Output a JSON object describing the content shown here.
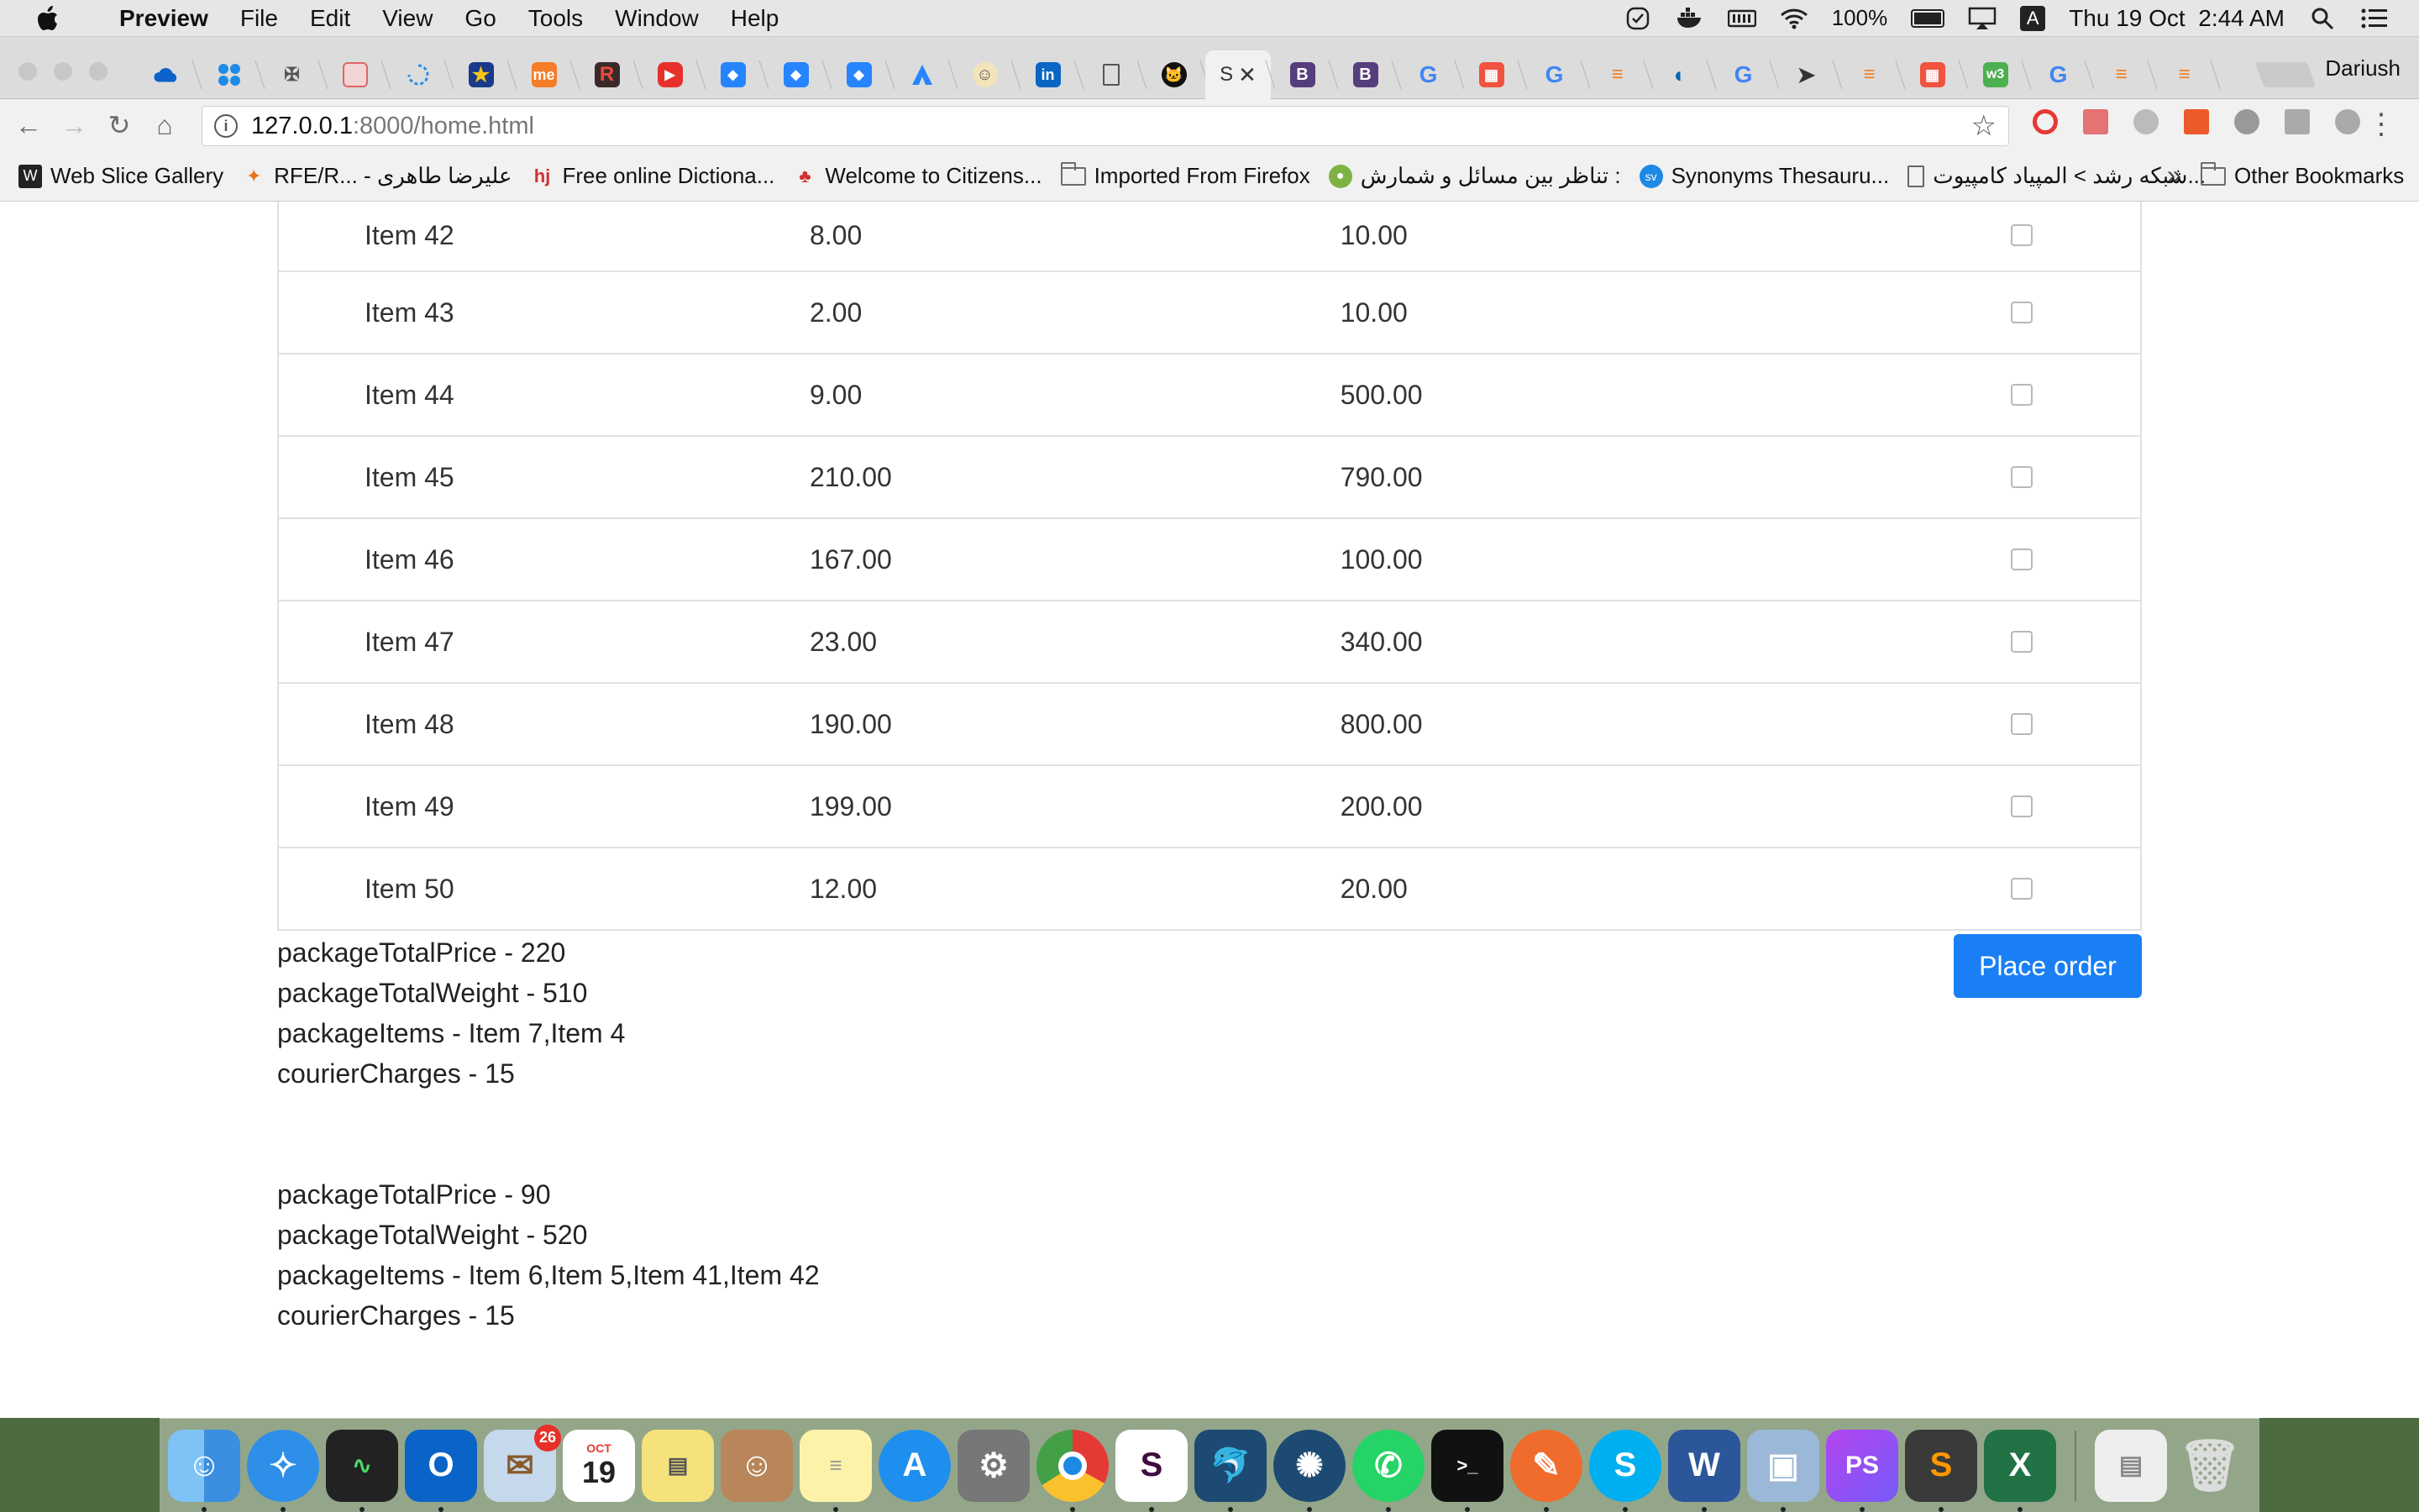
{
  "menubar": {
    "app_name": "Preview",
    "menus": [
      "File",
      "Edit",
      "View",
      "Go",
      "Tools",
      "Window",
      "Help"
    ],
    "battery_percent": "100%",
    "input_source": "A",
    "clock": "Thu 19 Oct  2:44 AM"
  },
  "browser": {
    "profile_name": "Dariush",
    "active_tab_title": "S",
    "url_host": "127.0.0.1",
    "url_path": ":8000/home.html",
    "bookmarks": [
      {
        "label": "Web Slice Gallery",
        "icon": "web-slice-icon"
      },
      {
        "label": "RFE/R... - علیرضا طاهری",
        "icon": "rfe-icon"
      },
      {
        "label": "Free online Dictiona...",
        "icon": "hj-icon"
      },
      {
        "label": "Welcome to Citizens...",
        "icon": "maple-leaf-icon"
      },
      {
        "label": "Imported From Firefox",
        "icon": "folder-icon"
      },
      {
        "label": "تناظر بین مسائل و شمارش :",
        "icon": "green-leaf-icon"
      },
      {
        "label": "Synonyms Thesauru...",
        "icon": "sv-icon"
      },
      {
        "label": "شبکه رشد > المپیاد کامپیوت...",
        "icon": "document-icon"
      }
    ],
    "other_bookmarks": "Other Bookmarks",
    "overflow": "»"
  },
  "table": {
    "rows": [
      {
        "name": "Item 42",
        "price": "8.00",
        "weight": "10.00"
      },
      {
        "name": "Item 43",
        "price": "2.00",
        "weight": "10.00"
      },
      {
        "name": "Item 44",
        "price": "9.00",
        "weight": "500.00"
      },
      {
        "name": "Item 45",
        "price": "210.00",
        "weight": "790.00"
      },
      {
        "name": "Item 46",
        "price": "167.00",
        "weight": "100.00"
      },
      {
        "name": "Item 47",
        "price": "23.00",
        "weight": "340.00"
      },
      {
        "name": "Item 48",
        "price": "190.00",
        "weight": "800.00"
      },
      {
        "name": "Item 49",
        "price": "199.00",
        "weight": "200.00"
      },
      {
        "name": "Item 50",
        "price": "12.00",
        "weight": "20.00"
      }
    ]
  },
  "place_order_label": "Place order",
  "packages": [
    {
      "total_price": "packageTotalPrice - 220",
      "total_weight": "packageTotalWeight - 510",
      "items": "packageItems - Item 7,Item 4",
      "courier": "courierCharges - 15"
    },
    {
      "total_price": "packageTotalPrice - 90",
      "total_weight": "packageTotalWeight - 520",
      "items": "packageItems - Item 6,Item 5,Item 41,Item 42",
      "courier": "courierCharges - 15"
    }
  ],
  "dock": {
    "calendar_month": "OCT",
    "calendar_day": "19",
    "mail_badge": "26"
  },
  "colors": {
    "accent": "#1a7ff4",
    "table_border": "#dee2e6"
  }
}
